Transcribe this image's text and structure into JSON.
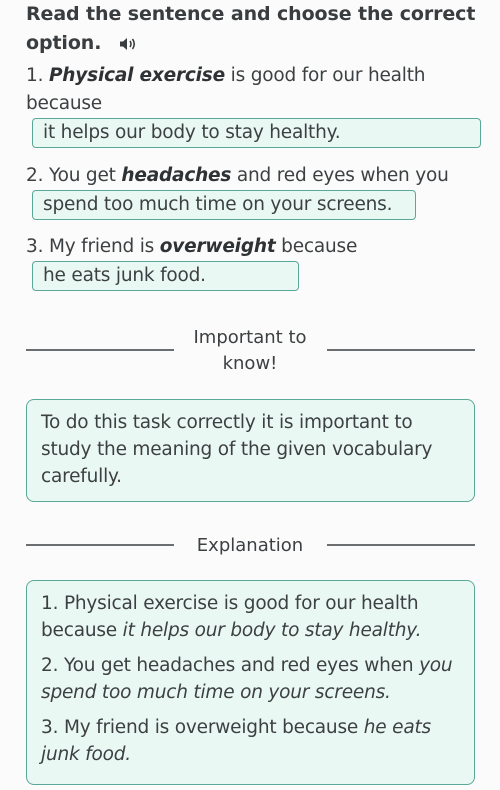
{
  "instruction": {
    "title": "Read the sentence and choose the correct option.",
    "audio_icon": "speaker-icon"
  },
  "questions": [
    {
      "number": "1.",
      "before": "",
      "keyword": "Physical exercise",
      "after": " is good for our health because",
      "answer": "it helps our body to stay healthy."
    },
    {
      "number": "2.",
      "before": "You get ",
      "keyword": "headaches",
      "after": " and red eyes when you",
      "answer": "spend too much time on your screens."
    },
    {
      "number": "3.",
      "before": "My friend is ",
      "keyword": "overweight",
      "after": " because",
      "answer": "he eats junk food."
    }
  ],
  "important": {
    "heading": "Important to know!",
    "text": "To do this task correctly it is important to study the meaning of the given vocabulary carefully."
  },
  "explanation": {
    "heading": "Explanation",
    "items": [
      {
        "number": "1.",
        "plain": " Physical exercise is good for our health because ",
        "italic": "it helps our body to stay healthy."
      },
      {
        "number": "2.",
        "plain": " You get headaches and red eyes when ",
        "italic": "you spend too much time on your screens."
      },
      {
        "number": "3.",
        "plain": " My friend is overweight because ",
        "italic": "he eats junk food."
      }
    ]
  },
  "colors": {
    "accent_border": "#5aa898",
    "accent_fill": "#eaf8f4",
    "text": "#3d4042"
  }
}
